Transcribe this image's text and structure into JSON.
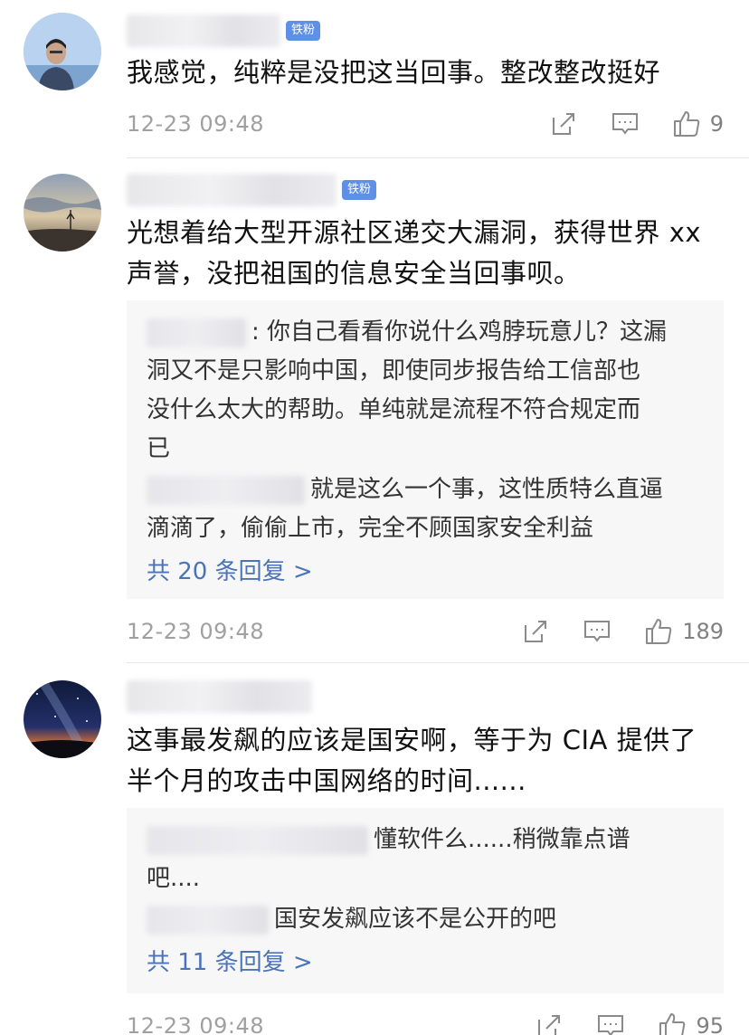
{
  "comments": [
    {
      "badge": "铁粉",
      "text": "我感觉，纯粹是没把这当回事。整改整改挺好",
      "time": "12-23 09:48",
      "likes": "9",
      "avatar": "person-photo"
    },
    {
      "badge": "铁粉",
      "text_lines": [
        "光想着给大型开源社区递交大漏洞，获得世界 xx",
        "声誉，没把祖国的信息安全当回事呗。"
      ],
      "replies": [
        {
          "lines": [
            ": 你自己看看你说什么鸡脖玩意儿？这漏",
            "洞又不是只影响中国，即使同步报告给工信部也",
            "没什么太大的帮助。单纯就是流程不符合规定而",
            "已"
          ]
        },
        {
          "lines": [
            "就是这么一个事，这性质特么直逼",
            "滴滴了，偷偷上市，完全不顾国家安全利益"
          ]
        }
      ],
      "more_replies": "共 20 条回复 >",
      "time": "12-23 09:48",
      "likes": "189",
      "avatar": "sky-landscape"
    },
    {
      "text_lines": [
        "这事最发飙的应该是国安啊，等于为 CIA 提供了",
        "半个月的攻击中国网络的时间......"
      ],
      "replies": [
        {
          "lines": [
            "懂软件么......稍微靠点谱",
            "吧...."
          ]
        },
        {
          "lines": [
            "国安发飙应该不是公开的吧"
          ]
        }
      ],
      "more_replies": "共 11 条回复 >",
      "time": "12-23 09:48",
      "likes": "95",
      "avatar": "night-sky-photo"
    }
  ],
  "icons": {
    "share": "share-icon",
    "comment": "comment-icon",
    "like": "thumbs-up-icon"
  },
  "colors": {
    "badge": "#5f8fe6",
    "link": "#4b74b8",
    "reply_bg": "#f7f7f7",
    "meta": "#a0a0a0"
  }
}
